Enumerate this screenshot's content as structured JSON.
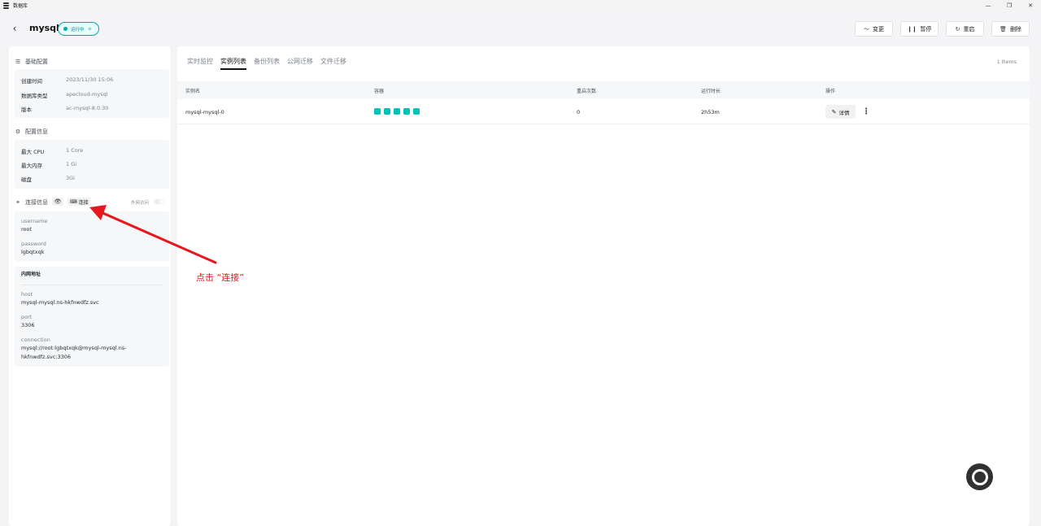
{
  "window": {
    "title": "数据库",
    "controls": {
      "minimize": "—",
      "restore": "❐",
      "close": "✕"
    }
  },
  "header": {
    "db_name": "mysql",
    "status": "运行中",
    "actions": [
      {
        "label": "变更",
        "icon": "trend-icon"
      },
      {
        "label": "暂停",
        "icon": "pause-icon"
      },
      {
        "label": "重启",
        "icon": "restart-icon"
      },
      {
        "label": "删除",
        "icon": "trash-icon"
      }
    ]
  },
  "basic": {
    "title": "基础配置",
    "items": [
      {
        "key": "创建时间",
        "value": "2023/11/30 15:06"
      },
      {
        "key": "数据库类型",
        "value": "apecloud-mysql"
      },
      {
        "key": "版本",
        "value": "ac-mysql-8.0.30"
      }
    ]
  },
  "config": {
    "title": "配置信息",
    "items": [
      {
        "key": "最大 CPU",
        "value": "1 Core"
      },
      {
        "key": "最大内存",
        "value": "1 Gi"
      },
      {
        "key": "磁盘",
        "value": "3Gi"
      }
    ]
  },
  "connection": {
    "title": "连接信息",
    "connect_label": "连接",
    "external_label": "外网访问",
    "external_enabled": false,
    "username_label": "username",
    "username": "root",
    "password_label": "password",
    "password": "lgbqtxqk",
    "internal_title": "内网地址",
    "host_label": "host",
    "host": "mysql-mysql.ns-hkfnwdfz.svc",
    "port_label": "port",
    "port": "3306",
    "connection_label": "connection",
    "connection_line1": "mysql://root:lgbqtxqk@mysql-mysql.ns-",
    "connection_line2": "hkfnwdfz.svc:3306"
  },
  "tabs": {
    "items": [
      "实时监控",
      "实例列表",
      "备份列表",
      "公网迁移",
      "文件迁移"
    ],
    "active": "实例列表",
    "count": "1 Items"
  },
  "table": {
    "headers": [
      "实例名",
      "容器",
      "重启次数",
      "运行时长",
      "操作"
    ],
    "rows": [
      {
        "name": "mysql-mysql-0",
        "containers": 5,
        "restarts": "0",
        "uptime": "2h53m",
        "detail_label": "详情"
      }
    ]
  },
  "annotation": {
    "text": "点击 “连接”",
    "color": "#e8161d"
  },
  "colors": {
    "accent": "#00a9a6",
    "container": "#00c2b8"
  }
}
